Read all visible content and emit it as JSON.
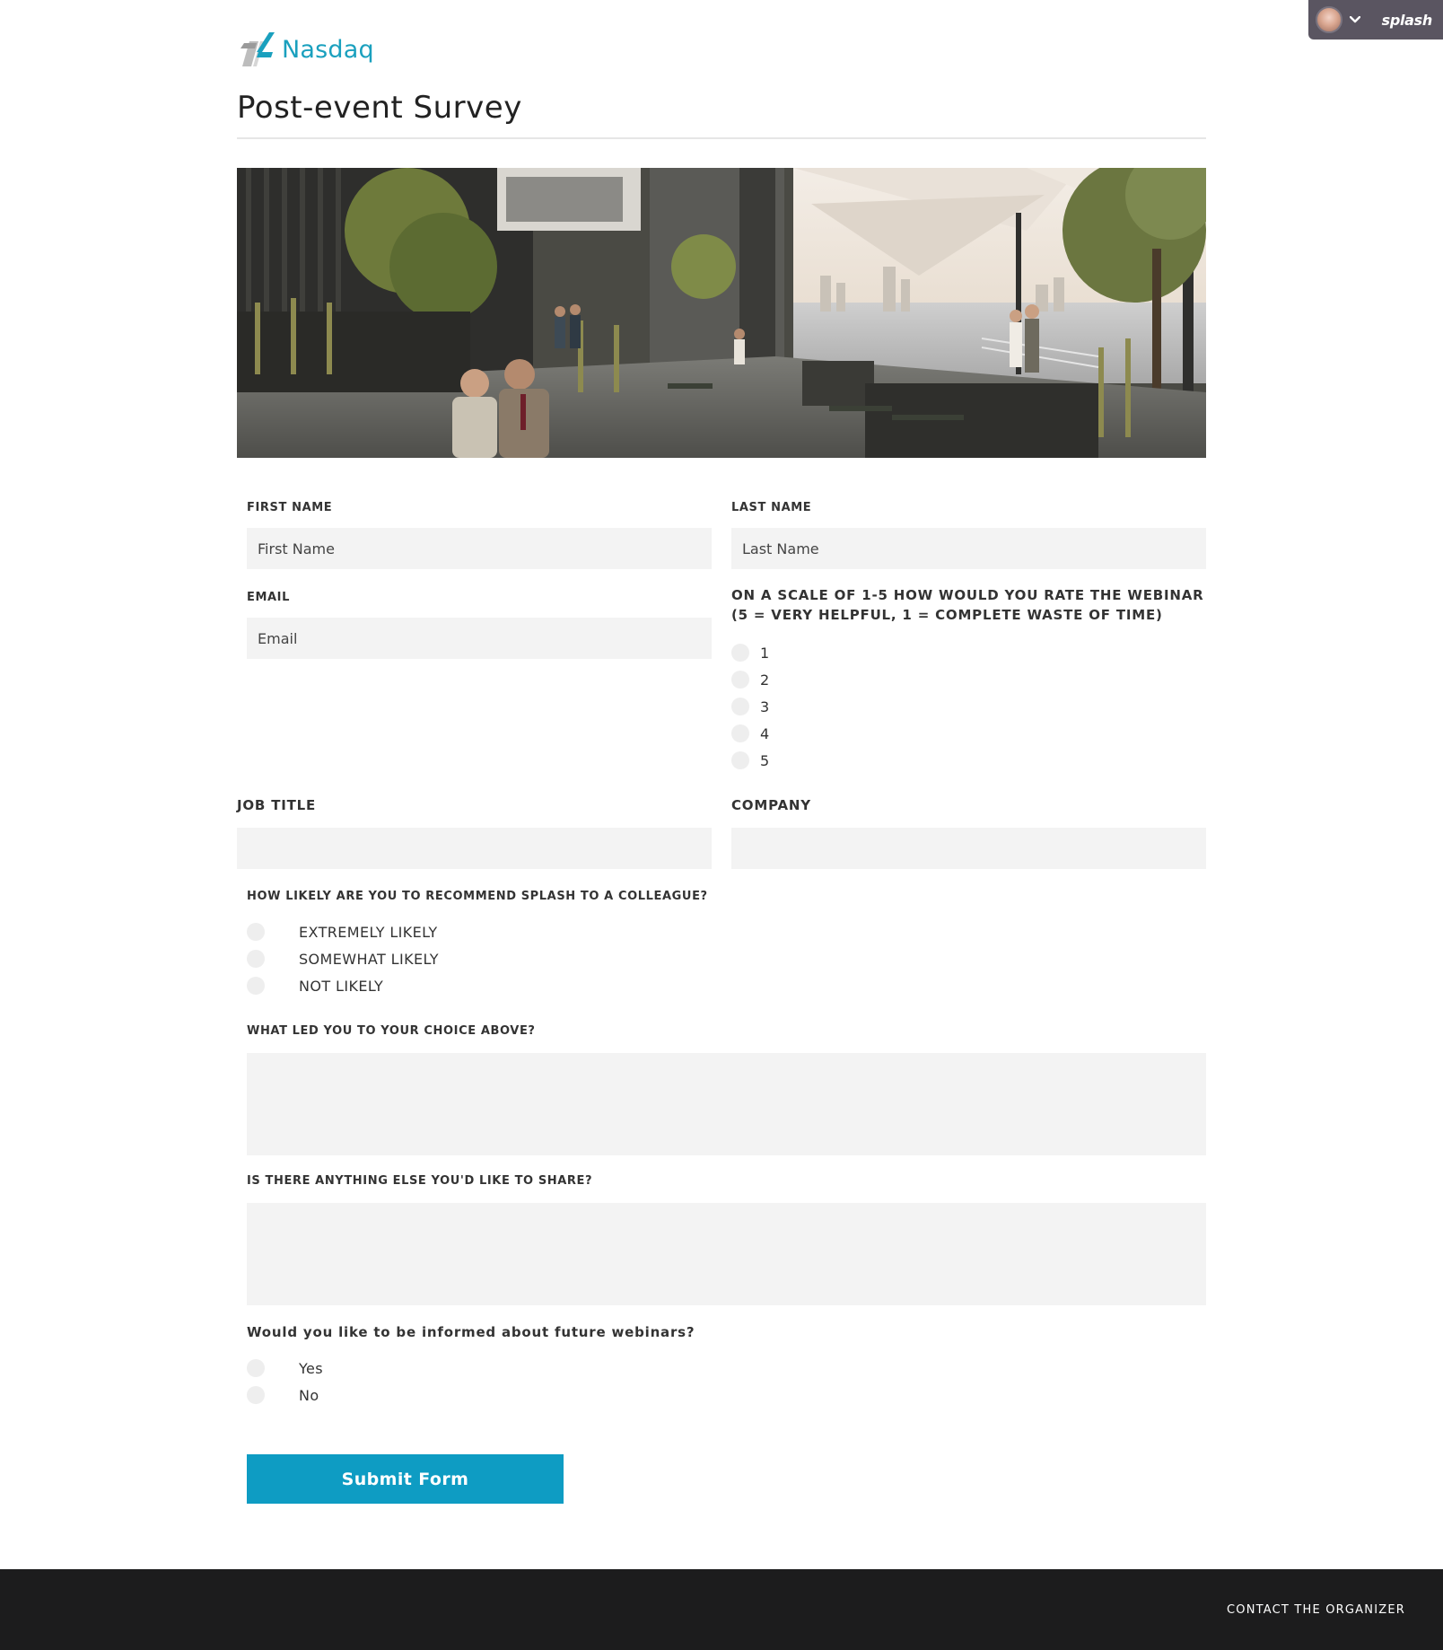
{
  "badge": {
    "brand": "splash"
  },
  "header": {
    "logo_text": "Nasdaq",
    "title": "Post-event Survey"
  },
  "form": {
    "first_name": {
      "label": "FIRST NAME",
      "placeholder": "First Name"
    },
    "last_name": {
      "label": "LAST NAME",
      "placeholder": "Last Name"
    },
    "email": {
      "label": "EMAIL",
      "placeholder": "Email"
    },
    "rating": {
      "label": "ON A SCALE OF 1-5 HOW WOULD YOU RATE THE WEBINAR (5 = VERY HELPFUL, 1 = COMPLETE WASTE OF TIME)",
      "options": [
        "1",
        "2",
        "3",
        "4",
        "5"
      ]
    },
    "job_title": {
      "label": "JOB TITLE"
    },
    "company": {
      "label": "COMPANY"
    },
    "recommend": {
      "label": "HOW LIKELY ARE YOU TO RECOMMEND SPLASH TO A COLLEAGUE?",
      "options": [
        "EXTREMELY LIKELY",
        "SOMEWHAT LIKELY",
        "NOT LIKELY"
      ]
    },
    "reason": {
      "label": "WHAT LED YOU TO YOUR CHOICE ABOVE?"
    },
    "anything_else": {
      "label": "IS THERE ANYTHING ELSE YOU'D LIKE TO SHARE?"
    },
    "future_webinars": {
      "label": "Would you like to be informed about future webinars?",
      "options": [
        "Yes",
        "No"
      ]
    },
    "submit_label": "Submit Form"
  },
  "footer": {
    "contact_label": "CONTACT THE ORGANIZER"
  },
  "colors": {
    "accent": "#0e9cc3",
    "logo": "#1aa0be",
    "footer_bg": "#1c1c1d",
    "field_bg": "#f3f3f3",
    "badge_bg": "#5a5561"
  },
  "icons": [
    "user-avatar-icon",
    "chevron-down-icon",
    "nasdaq-logo-icon"
  ]
}
